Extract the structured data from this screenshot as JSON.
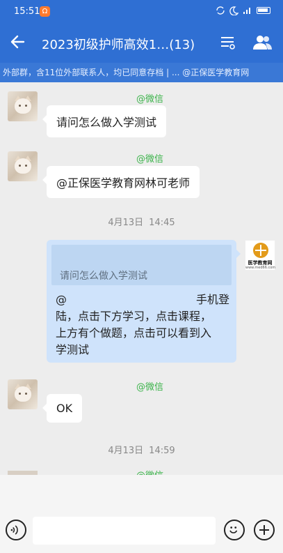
{
  "status_bar": {
    "time": "15:51",
    "notification_badge": "Ω"
  },
  "header": {
    "title": "2023初级护师高效1…(13)",
    "icons": {
      "back": "arrow-left-icon",
      "menu": "list-settings-icon",
      "members": "group-members-icon"
    }
  },
  "notice": {
    "text": "外部群，含11位外部联系人，均已同意存档 | ... @正保医学教育网"
  },
  "messages": [
    {
      "sender": "@微信",
      "text": "请问怎么做入学测试"
    },
    {
      "sender": "@微信",
      "text": "@正保医学教育网林可老师"
    },
    {
      "timestamp_date": "4月13日",
      "timestamp_time": "14:45"
    },
    {
      "quote": "请问怎么做入学测试",
      "reply_at": "@",
      "reply_tail": "手机登",
      "reply_lines": [
        "陆，点击下方学习，点击课程，",
        "上方有个做题，点击可以看到入",
        "学测试"
      ]
    },
    {
      "sender": "@微信",
      "text": "OK"
    },
    {
      "timestamp_date": "4月13日",
      "timestamp_time": "14:59"
    },
    {
      "sender": "@微信"
    }
  ],
  "org_avatar": {
    "name": "医学教育网",
    "url": "www.med66.com"
  },
  "input": {
    "placeholder": ""
  },
  "colors": {
    "header": "#2f6fd3",
    "sender": "#3bb34a",
    "reply_bubble": "#cfe3fb"
  }
}
